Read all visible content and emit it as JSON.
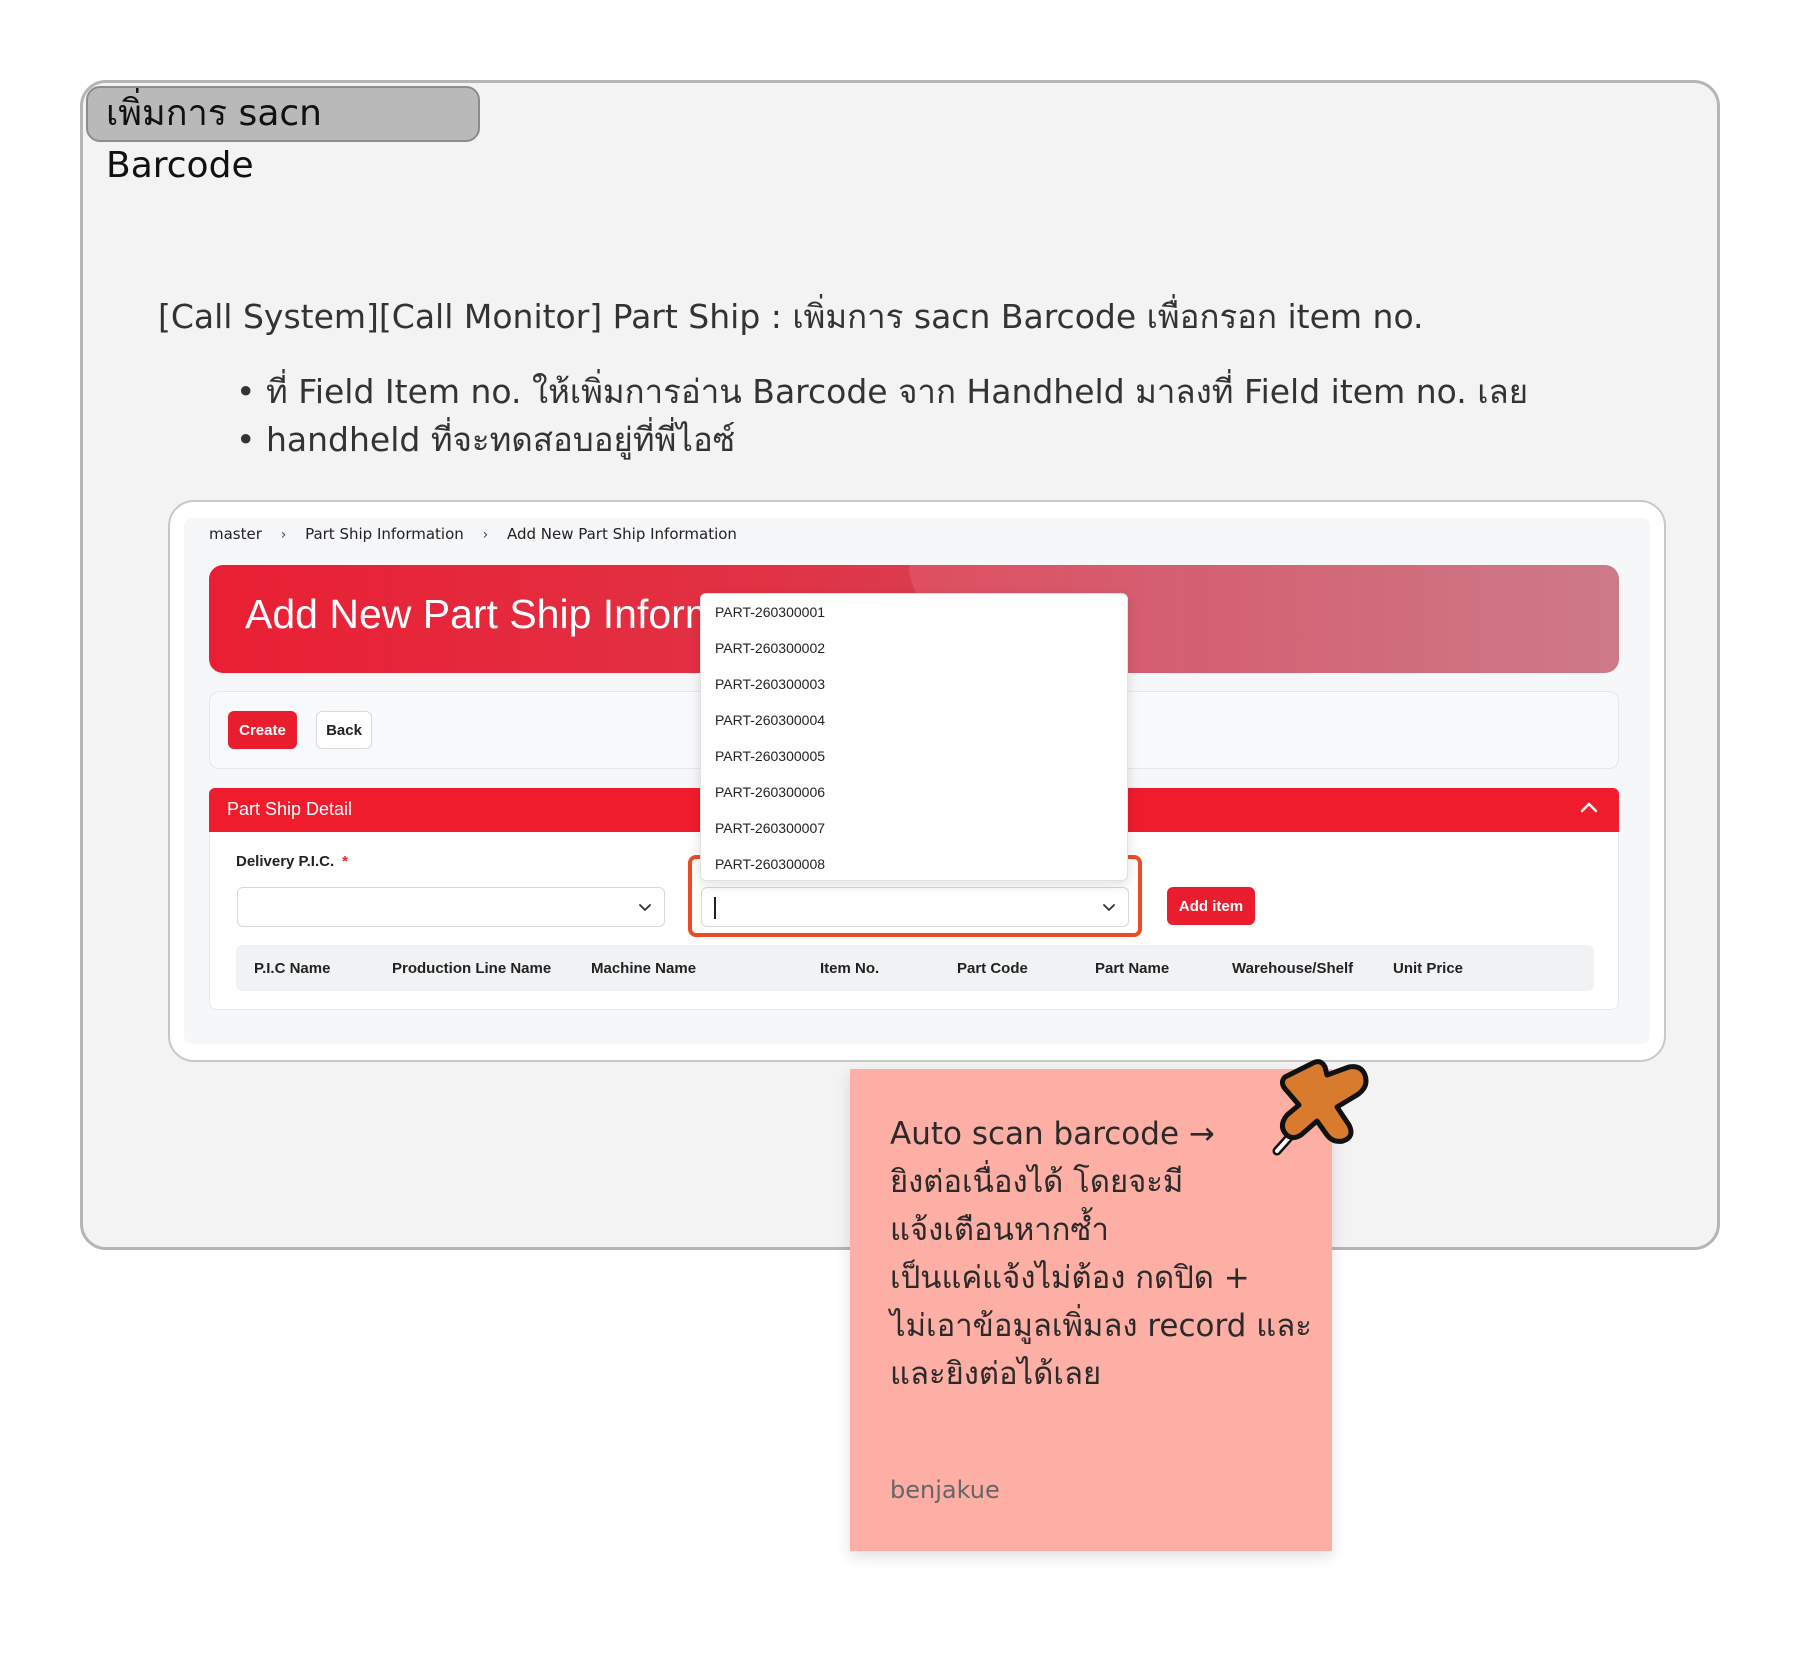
{
  "board": {
    "tag": "เพิ่มการ sacn Barcode",
    "heading": "[Call System][Call Monitor] Part Ship : เพิ่มการ sacn Barcode เพื่อกรอก item no.",
    "bullets": [
      "ที่ Field Item no. ให้เพิ่มการอ่าน Barcode จาก Handheld มาลงที่ Field item no. เลย",
      "handheld ที่จะทดสอบอยู่ที่พี่ไอซ์"
    ]
  },
  "app": {
    "breadcrumb": [
      "master",
      "Part Ship Information",
      "Add New Part Ship Information"
    ],
    "page_title": "Add New Part Ship Information",
    "buttons": {
      "create": "Create",
      "back": "Back",
      "add_item": "Add item"
    },
    "section": {
      "title": "Part Ship Detail"
    },
    "delivery_pic_label": "Delivery P.I.C.",
    "required_mark": "*",
    "table_headers": [
      "P.I.C Name",
      "Production Line Name",
      "Machine Name",
      "Item No.",
      "Part Code",
      "Part Name",
      "Warehouse/Shelf",
      "Unit Price"
    ],
    "item_options": [
      "PART-260300001",
      "PART-260300002",
      "PART-260300003",
      "PART-260300004",
      "PART-260300005",
      "PART-260300006",
      "PART-260300007",
      "PART-260300008"
    ]
  },
  "note": {
    "lines": [
      "Auto scan barcode →",
      "ยิงต่อเนื่องได้ โดยจะมี",
      "แจ้งเตือนหากซ้ำ",
      "เป็นแค่แจ้งไม่ต้อง กดปิด +",
      "ไม่เอาข้อมูลเพิ่มลง record และ",
      "และยิงต่อได้เลย"
    ],
    "author": "benjakue"
  },
  "colors": {
    "brand_red": "#ea1d2f",
    "highlight": "#ee4b22",
    "note_bg": "#fdafa5",
    "pin": "#d97b2e"
  }
}
